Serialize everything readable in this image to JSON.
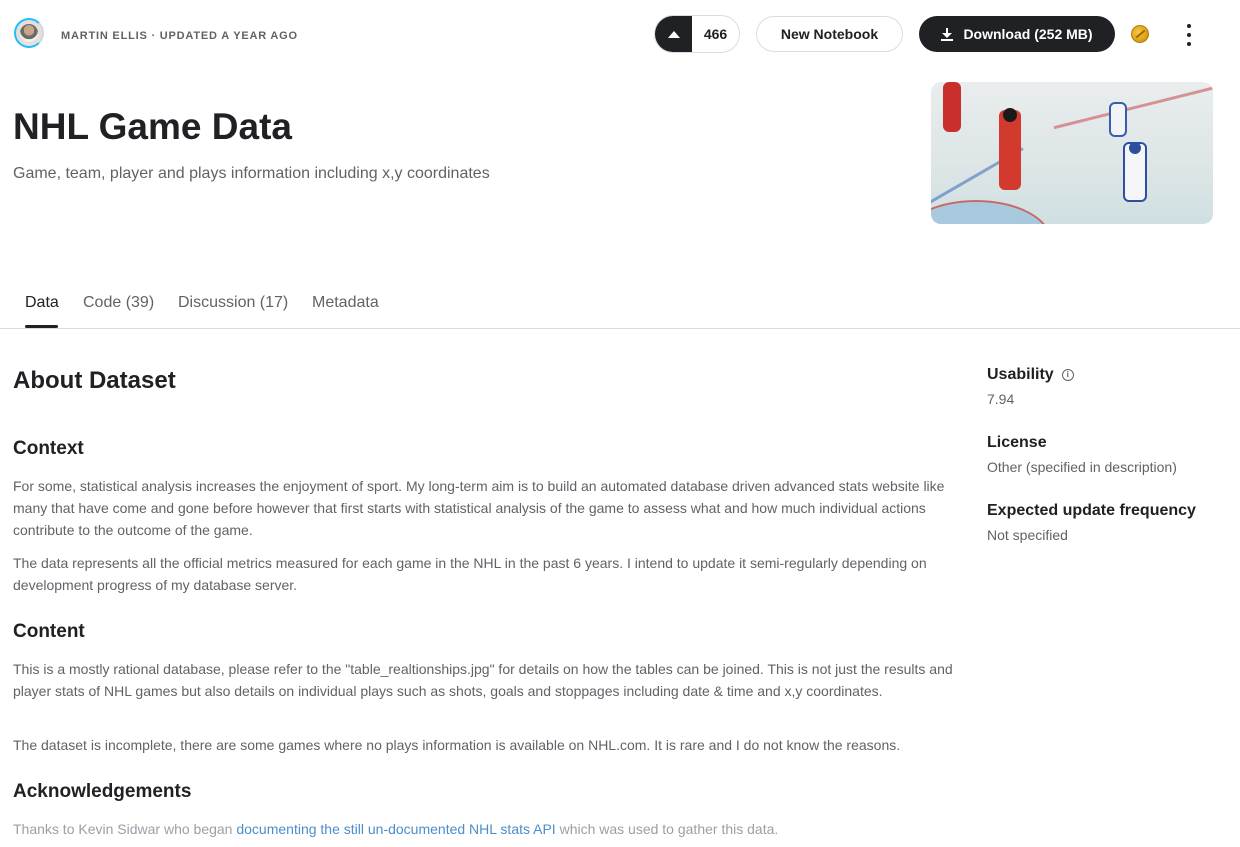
{
  "header": {
    "author": "MARTIN ELLIS",
    "separator": " · ",
    "updated": "UPDATED A YEAR AGO",
    "vote_count": "466",
    "new_notebook_label": "New Notebook",
    "download_label": "Download (252 MB)"
  },
  "dataset": {
    "title": "NHL Game Data",
    "subtitle": "Game, team, player and plays information including x,y coordinates"
  },
  "tabs": [
    {
      "label": "Data",
      "active": true
    },
    {
      "label": "Code (39)"
    },
    {
      "label": "Discussion (17)"
    },
    {
      "label": "Metadata"
    }
  ],
  "about": {
    "heading": "About Dataset",
    "context_heading": "Context",
    "context_p1": "For some, statistical analysis increases the enjoyment of sport. My long-term aim is to build an automated database driven advanced stats website like many that have come and gone before however that first starts with statistical analysis of the game to assess what and how much individual actions contribute to the outcome of the game.",
    "context_p2": "The data represents all the official metrics measured for each game in the NHL in the past 6 years. I intend to update it semi-regularly depending on development progress of my database server.",
    "content_heading": "Content",
    "content_p1": "This is a mostly rational database, please refer to the \"table_realtionships.jpg\" for details on how the tables can be joined. This is not just the results and player stats of NHL games but also details on individual plays such as shots, goals and stoppages including date & time and x,y coordinates.",
    "content_p2": "The dataset is incomplete, there are some games where no plays information is available on NHL.com. It is rare and I do not know the reasons.",
    "ack_heading": "Acknowledgements",
    "ack_prefix": "Thanks to Kevin Sidwar who began ",
    "ack_link": "documenting the still un-documented NHL stats API",
    "ack_suffix": " which was used to gather this data."
  },
  "sidebar": {
    "usability_label": "Usability",
    "usability_value": "7.94",
    "license_label": "License",
    "license_value": "Other (specified in description)",
    "frequency_label": "Expected update frequency",
    "frequency_value": "Not specified"
  },
  "colors": {
    "primary_dark": "#202124",
    "muted_text": "#5f6368",
    "link": "#4b8ecc",
    "border": "#dadce0"
  },
  "icons": [
    "upvote-icon",
    "download-icon",
    "medal-icon",
    "more-vert-icon",
    "info-icon"
  ]
}
